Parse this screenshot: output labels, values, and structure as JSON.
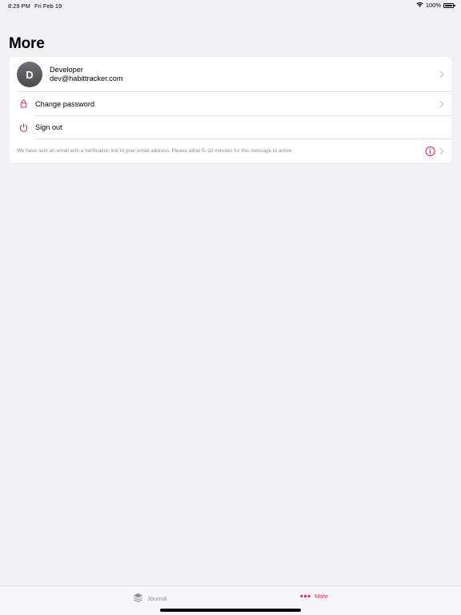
{
  "status_bar": {
    "time": "8:29 PM",
    "date": "Fri Feb 19",
    "battery": "100%",
    "battery_level": 1.0
  },
  "page": {
    "title": "More"
  },
  "profile": {
    "avatar_initial": "D",
    "name": "Developer",
    "email": "dev@habittracker.com",
    "chevron_icon": "chevron-right-icon"
  },
  "menu": {
    "change_password": {
      "label": "Change password",
      "icon": "lock-icon"
    },
    "sign_out": {
      "label": "Sign out",
      "icon": "power-icon"
    }
  },
  "verification_note": {
    "text": "We have sent an email with a verification link to your email address. Please allow 5–10 minutes for this message to arrive.",
    "icon": "info-icon"
  },
  "tab_bar": {
    "tabs": [
      {
        "label": "Journal",
        "icon": "layers-icon",
        "selected": false
      },
      {
        "label": "More",
        "icon": "more-dots-icon",
        "selected": true
      }
    ]
  },
  "colors": {
    "accent": "#e0245e",
    "background": "#f2f1f6",
    "card": "#ffffff",
    "secondary_text": "#8e8e93"
  }
}
